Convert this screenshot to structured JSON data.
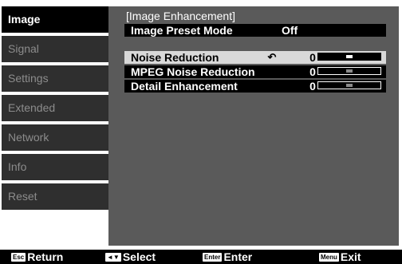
{
  "sidebar": {
    "items": [
      {
        "label": "Image",
        "active": true
      },
      {
        "label": "Signal",
        "active": false
      },
      {
        "label": "Settings",
        "active": false
      },
      {
        "label": "Extended",
        "active": false
      },
      {
        "label": "Network",
        "active": false
      },
      {
        "label": "Info",
        "active": false
      },
      {
        "label": "Reset",
        "active": false
      }
    ]
  },
  "panel": {
    "title": "[Image Enhancement]",
    "preset": {
      "label": "Image Preset Mode",
      "value": "Off"
    },
    "settings": [
      {
        "label": "Noise Reduction",
        "value": "0",
        "selected": true,
        "icon": "reset-icon",
        "level": 0.5
      },
      {
        "label": "MPEG Noise Reduction",
        "value": "0",
        "selected": false,
        "level": 0.5
      },
      {
        "label": "Detail Enhancement",
        "value": "0",
        "selected": false,
        "level": 0.5
      }
    ]
  },
  "footer": {
    "hints": [
      {
        "key": "Esc",
        "label": "Return"
      },
      {
        "key": "◄▼",
        "label": "Select"
      },
      {
        "key": "Enter",
        "label": "Enter"
      },
      {
        "key": "Menu",
        "label": "Exit"
      }
    ]
  },
  "colors": {
    "panel_bg": "#5a5a5a",
    "sidebar_inactive": "#2f2f2f",
    "selected_row": "#d9d9d9"
  }
}
